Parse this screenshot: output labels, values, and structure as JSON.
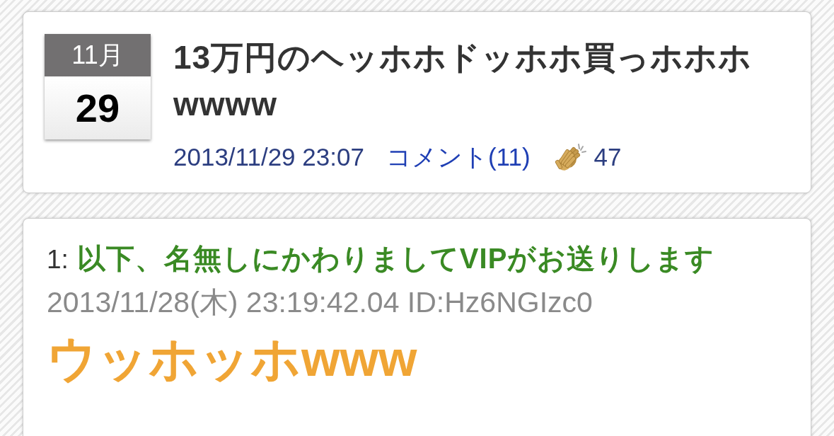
{
  "article": {
    "date_badge": {
      "month": "11月",
      "day": "29"
    },
    "title": "13万円のヘッホホドッホホ買っホホホwwww",
    "posted_at": "2013/11/29 23:07",
    "comments_link": "コメント(11)",
    "claps": "47"
  },
  "posts": [
    {
      "number": "1:",
      "name": "以下、名無しにかわりましてVIPがお送りします",
      "meta": "2013/11/28(木) 23:19:42.04 ID:Hz6NGIzc0",
      "body": "ウッホッホwww"
    }
  ]
}
